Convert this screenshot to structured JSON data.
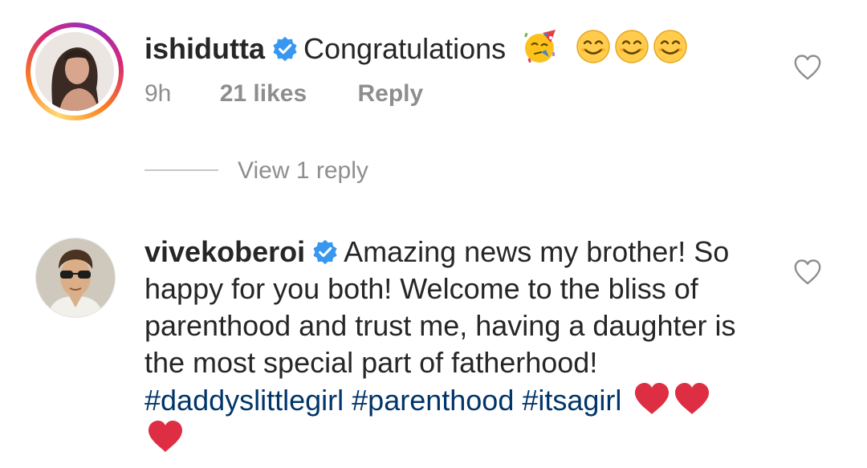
{
  "comments": [
    {
      "username": "ishidutta",
      "text": "Congratulations",
      "emojis": [
        "partying-face-emoji",
        "smiling-face-emoji",
        "smiling-face-emoji",
        "smiling-face-emoji"
      ],
      "time": "9h",
      "likes": "21 likes",
      "reply_label": "Reply",
      "view_replies": "View 1 reply"
    },
    {
      "username": "vivekoberoi",
      "text": "Amazing news my brother! So happy for you both! Welcome to the bliss of parenthood and trust me, having a daughter is the most special part of fatherhood!",
      "hashtags": [
        "#daddyslittlegirl",
        "#parenthood",
        "#itsagirl"
      ],
      "emojis": [
        "red-heart-emoji",
        "red-heart-emoji",
        "red-heart-emoji"
      ]
    }
  ],
  "colors": {
    "text": "#262626",
    "muted": "#8e8e8e",
    "hashtag": "#003569",
    "verified": "#3897f0",
    "heart_emoji": "#dd2e44"
  }
}
